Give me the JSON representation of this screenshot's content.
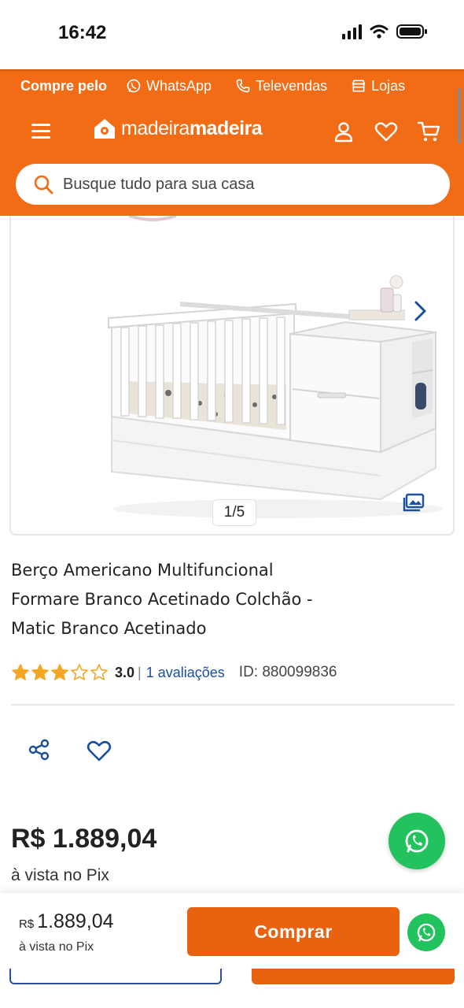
{
  "status_bar": {
    "time": "16:42"
  },
  "promo": {
    "lead": "Compre pelo",
    "items": [
      "WhatsApp",
      "Televendas",
      "Lojas"
    ]
  },
  "header": {
    "logo_light": "madeira",
    "logo_bold": "madeira",
    "search_placeholder": "Busque tudo para sua casa"
  },
  "gallery": {
    "counter": "1/5"
  },
  "product": {
    "title": "Berço Americano Multifuncional Formare Branco Acetinado Colchão - Matic Branco Acetinado",
    "rating": 3.0,
    "rating_label": "3.0",
    "rating_max": 5,
    "separator": "|",
    "reviews": "1 avaliações",
    "id": "ID: 880099836"
  },
  "pricing": {
    "price": "R$ 1.889,04",
    "note": "à vista no Pix"
  },
  "sticky": {
    "currency": "R$",
    "amount": "1.889,04",
    "note": "à vista no Pix",
    "buy_label": "Comprar"
  },
  "colors": {
    "brand_orange": "#f26b15",
    "button_orange": "#e8620f",
    "whatsapp_green": "#22c35e",
    "link_blue": "#1a4fa0",
    "star_gold": "#f5a623"
  },
  "icons": {
    "header": [
      "menu-icon",
      "user-icon",
      "heart-icon",
      "cart-icon"
    ],
    "actions": [
      "share-icon",
      "heart-outline-icon"
    ]
  }
}
